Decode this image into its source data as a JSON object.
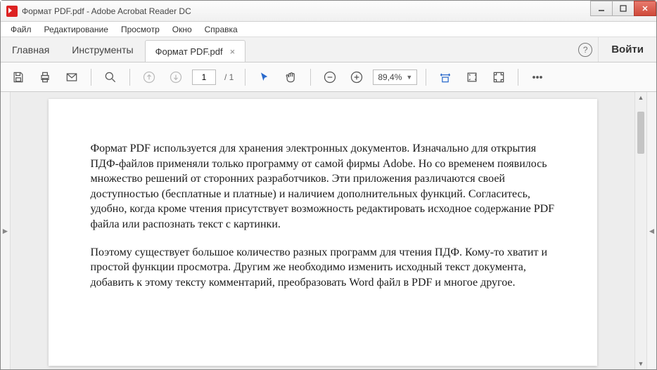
{
  "window": {
    "title": "Формат PDF.pdf - Adobe Acrobat Reader DC"
  },
  "menu": {
    "file": "Файл",
    "edit": "Редактирование",
    "view": "Просмотр",
    "window": "Окно",
    "help": "Справка"
  },
  "tabs": {
    "home": "Главная",
    "tools": "Инструменты",
    "doc": "Формат PDF.pdf",
    "signin": "Войти"
  },
  "toolbar": {
    "page_current": "1",
    "page_total": "/ 1",
    "zoom": "89,4%"
  },
  "document": {
    "para1": "Формат PDF используется для хранения электронных документов. Изначально для открытия ПДФ-файлов применяли только программу от самой фирмы Adobe. Но со временем появилось множество решений от сторонних разработчиков. Эти приложения различаются своей доступностью (бесплатные и платные) и наличием дополнительных функций. Согласитесь, удобно, когда кроме чтения присутствует возможность редактировать исходное содержание PDF файла или распознать текст с картинки.",
    "para2": "Поэтому существует большое количество разных программ для чтения ПДФ. Кому-то хватит и простой функции просмотра. Другим же необходимо изменить исходный текст документа, добавить к этому тексту комментарий, преобразовать Word файл в PDF и многое другое."
  }
}
